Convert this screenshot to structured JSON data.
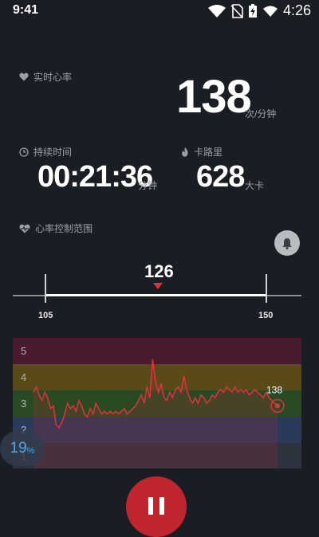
{
  "status": {
    "time": "9:41",
    "right_text": "4:26"
  },
  "heart_rate": {
    "label": "实时心率",
    "value": "138",
    "unit": "次/分钟"
  },
  "duration": {
    "label": "持续时间",
    "value": "00:21:36",
    "unit": "分钟"
  },
  "calories": {
    "label": "卡路里",
    "value": "628",
    "unit": "大卡"
  },
  "range": {
    "label": "心率控制范围",
    "current": "126",
    "min": "105",
    "max": "150"
  },
  "chart_data": {
    "type": "line",
    "zones": [
      {
        "label": "5",
        "color": "#4a1a2e"
      },
      {
        "label": "4",
        "color": "#5a4a1a"
      },
      {
        "label": "3",
        "color": "#2a4a24"
      },
      {
        "label": "2",
        "color": "#2a3a58"
      },
      {
        "label": "1",
        "color": "#2e3340"
      }
    ],
    "ylim": [
      1,
      5.8
    ],
    "values": [
      3.8,
      4.0,
      3.7,
      3.5,
      3.8,
      3.6,
      3.2,
      3.3,
      2.6,
      2.5,
      2.7,
      3.0,
      3.4,
      3.2,
      3.3,
      3.1,
      3.5,
      3.3,
      3.0,
      2.9,
      3.2,
      3.0,
      3.4,
      3.2,
      3.0,
      3.1,
      3.0,
      3.1,
      3.0,
      3.1,
      3.0,
      3.1,
      3.2,
      3.0,
      3.1,
      3.2,
      3.3,
      3.5,
      3.7,
      3.4,
      4.0,
      3.6,
      5.0,
      4.2,
      3.8,
      4.1,
      3.6,
      3.5,
      3.8,
      3.6,
      3.9,
      4.0,
      3.8,
      4.4,
      3.9,
      3.6,
      3.4,
      3.6,
      3.4,
      3.7,
      3.6,
      3.4,
      3.5,
      3.7,
      3.6,
      3.8,
      3.9,
      3.8,
      4.0,
      3.9,
      3.8,
      4.0,
      3.8,
      3.9,
      3.8,
      3.9,
      3.7,
      3.8,
      3.9,
      3.8,
      3.7,
      3.6,
      3.8,
      3.6,
      3.5,
      3.4,
      3.3
    ],
    "end_label": "138",
    "line_color": "#e0323c"
  },
  "progress": {
    "value": "19",
    "sign": "%"
  },
  "colors": {
    "accent": "#c0262d",
    "range_marker": "#e0323c",
    "percent": "#4fa6e8"
  }
}
